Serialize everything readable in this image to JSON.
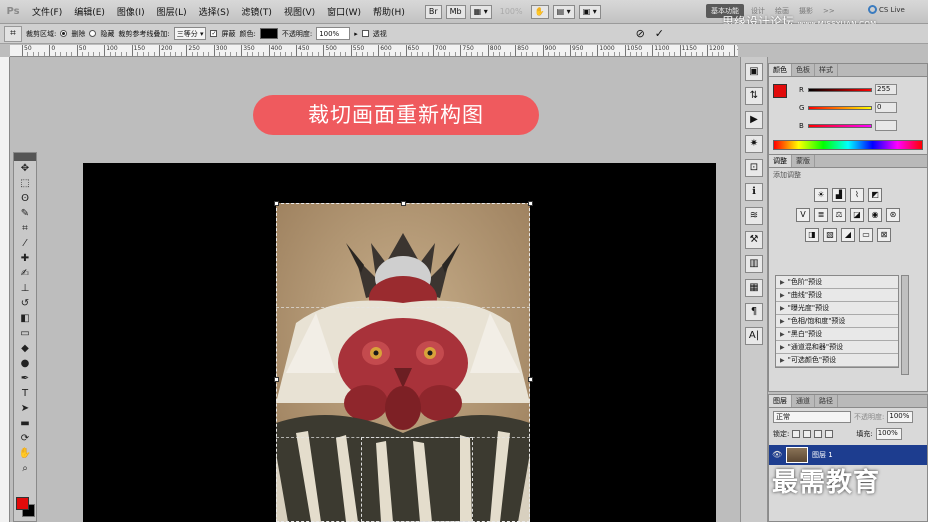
{
  "app": {
    "logo": "Ps"
  },
  "menu": [
    "文件(F)",
    "编辑(E)",
    "图像(I)",
    "图层(L)",
    "选择(S)",
    "滤镜(T)",
    "视图(V)",
    "窗口(W)",
    "帮助(H)"
  ],
  "menubar_tools": {
    "zoom": "100%"
  },
  "workspaces": {
    "active": "基本功能",
    "items": [
      "设计",
      "绘画",
      "摄影"
    ],
    "more": ">>"
  },
  "cslive": "CS Live",
  "watermark_top": {
    "text": "思缘设计论坛",
    "url": "www.MISSYUAN.COM"
  },
  "options": {
    "crop_area_label": "裁剪区域:",
    "delete_label": "删除",
    "hide_label": "隐藏",
    "guide_overlay_label": "裁剪参考线叠加:",
    "guide_overlay_value": "三等分",
    "shield_label": "屏蔽",
    "color_label": "颜色:",
    "opacity_label": "不透明度:",
    "opacity_value": "100%",
    "perspective_label": "透视",
    "cancel_icon": "⊘",
    "commit_icon": "✓"
  },
  "ruler": {
    "labels": [
      "50",
      "0",
      "50",
      "100",
      "150",
      "200",
      "250",
      "300",
      "350",
      "400",
      "450",
      "500",
      "550",
      "600",
      "650",
      "700",
      "750",
      "800",
      "850",
      "900",
      "950",
      "1000",
      "1050",
      "1100",
      "1150",
      "1200",
      "1250"
    ]
  },
  "canvas": {
    "title": "裁切画面重新构图"
  },
  "color_panel": {
    "tabs": [
      "颜色",
      "色板",
      "样式"
    ],
    "channels": [
      {
        "name": "R",
        "value": "255"
      },
      {
        "name": "G",
        "value": "0"
      },
      {
        "name": "B",
        "value": ""
      }
    ]
  },
  "adjust_panel": {
    "tabs": [
      "调整",
      "蒙版"
    ],
    "hint": "添加调整",
    "presets": [
      "\"色阶\"预设",
      "\"曲线\"预设",
      "\"曝光度\"预设",
      "\"色相/饱和度\"预设",
      "\"黑白\"预设",
      "\"通道混和器\"预设",
      "\"可选颜色\"预设"
    ]
  },
  "layers_panel": {
    "tabs": [
      "图层",
      "通道",
      "路径"
    ],
    "blend_mode": "正常",
    "opacity_label": "不透明度:",
    "opacity_value": "100%",
    "lock_label": "锁定:",
    "fill_label": "填充:",
    "fill_value": "100%",
    "layer_name": "图层 1"
  },
  "watermark_bottom": "最需教育",
  "colors": {
    "foreground": "#e20b0b",
    "background": "#000000",
    "title_pill": "#ef5a5e",
    "selected_layer": "#1d3d8f"
  }
}
